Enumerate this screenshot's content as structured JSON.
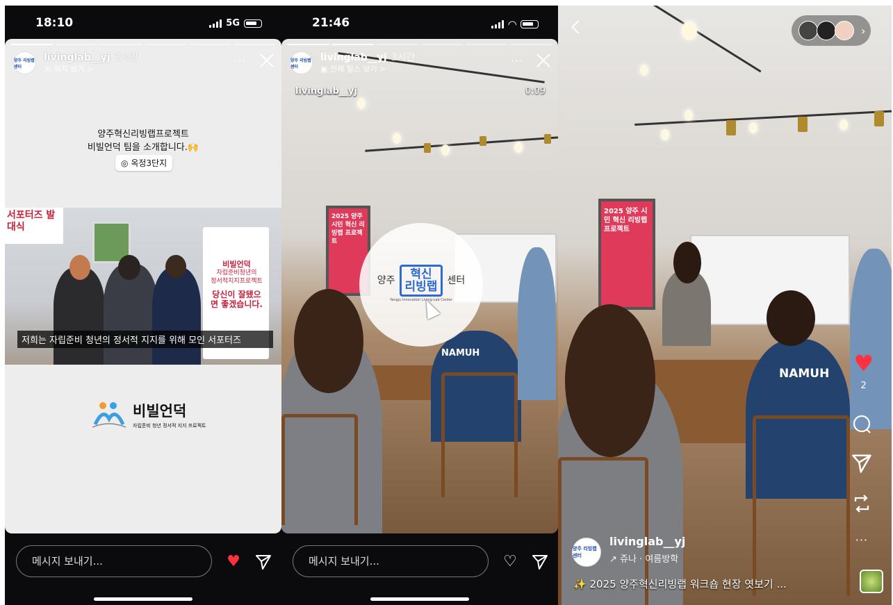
{
  "panel1": {
    "status": {
      "time": "18:10",
      "network": "5G"
    },
    "story": {
      "username": "livinglab__yj",
      "time_ago": "2시간",
      "sub_label": "위치 보기 >",
      "avatar_text": "양주 리빙랩 센터",
      "caption_lines": [
        "양주혁신리빙랩프로젝트",
        "비빌언덕 팀을 소개합니다.🙌"
      ],
      "location_tag": "옥정3단지",
      "photo": {
        "banner": "서포터즈 발대식",
        "poster_title": "비빌언덕",
        "poster_lines": [
          "자립준비청년의",
          "정서적지지프로젝트"
        ],
        "poster_slogan": "당신이 잘됐으면 좋겠습니다.",
        "subtitle": "저희는 자립준비 청년의 정서적 지지를 위해 모인 서포터즈"
      },
      "logo": {
        "name": "비빌언덕",
        "tagline": "자립준비 청년 정서적 지지 프로젝트"
      }
    },
    "message_placeholder": "메시지 보내기...",
    "liked": true
  },
  "panel2": {
    "status": {
      "time": "21:46"
    },
    "story": {
      "username": "livinglab__yj",
      "time_ago": "3시간",
      "sub_label": "전체 릴스 보기 >",
      "avatar_text": "양주 리빙랩 센터",
      "video_title": "livinglab__yj",
      "video_time": "0:09",
      "center_logo": {
        "left": "양주",
        "mid_top": "혁신",
        "mid_bottom": "리빙랩",
        "right": "센터",
        "tiny": "Yangju Innovation Living-Lab Center"
      },
      "poster_text": "2025 양주 시민 혁신 리빙랩 프로젝트"
    },
    "message_placeholder": "메시지 보내기..."
  },
  "panel3": {
    "like_count": "2",
    "username": "livinglab__yj",
    "music": "↗ 쥬나 · 여름방학",
    "caption": "✨ 2025 양주혁신리빙랩 워크숍 현장 엿보기 ...",
    "avatar_text": "양주 리빙랩 센터",
    "shirt_text": "NAMUH",
    "poster_text": "2025 양주 시민 혁신 리빙랩 프로젝트"
  },
  "colors": {
    "like_red": "#ff3040",
    "accent_blue": "#2e6bd0",
    "poster_red": "#e03a5a"
  }
}
